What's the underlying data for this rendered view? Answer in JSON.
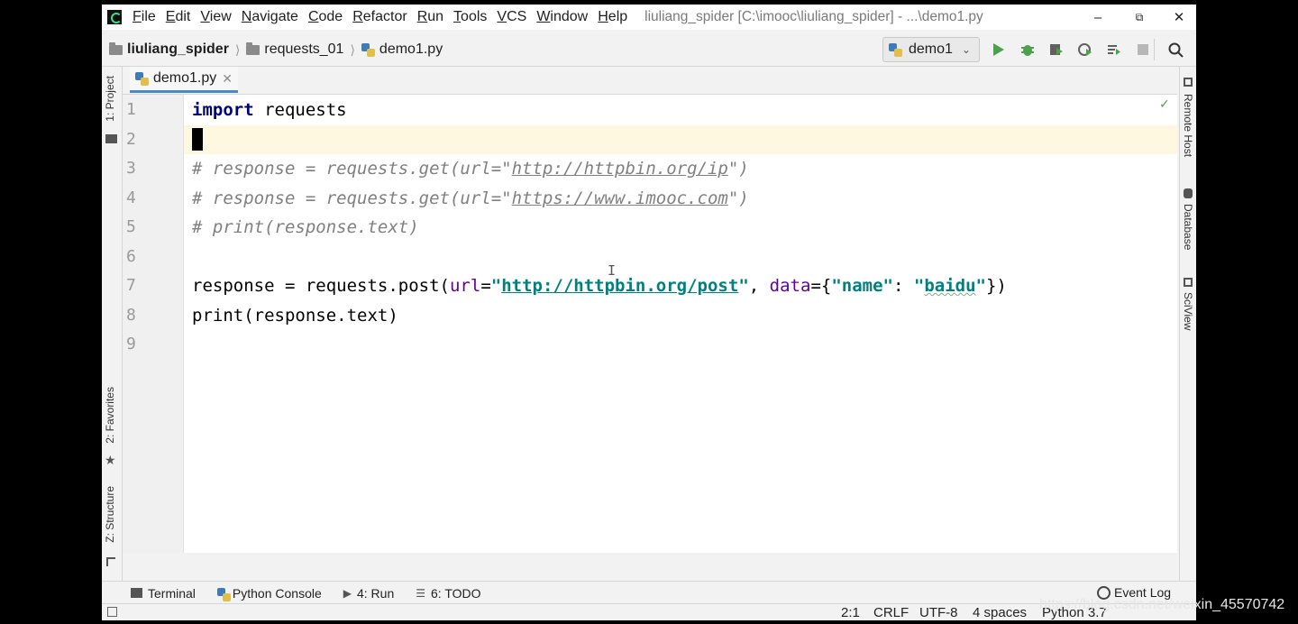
{
  "window": {
    "title_path": "liuliang_spider [C:\\imooc\\liuliang_spider] - ...\\demo1.py",
    "controls": {
      "minimize": "–",
      "restore": "⧉",
      "close": "✕"
    }
  },
  "menu": [
    "File",
    "Edit",
    "View",
    "Navigate",
    "Code",
    "Refactor",
    "Run",
    "Tools",
    "VCS",
    "Window",
    "Help"
  ],
  "breadcrumb": [
    "liuliang_spider",
    "requests_01",
    "demo1.py"
  ],
  "run_config": {
    "label": "demo1"
  },
  "tabs": [
    {
      "label": "demo1.py",
      "close": "✕"
    }
  ],
  "left_tools": {
    "project": "1: Project",
    "favorites": "2: Favorites",
    "structure": "Z: Structure"
  },
  "right_tools": {
    "remote_host": "Remote Host",
    "database": "Database",
    "sciview": "SciView"
  },
  "editor": {
    "line_numbers": [
      "1",
      "2",
      "3",
      "4",
      "5",
      "6",
      "7",
      "8",
      "9"
    ],
    "current_line": 2,
    "lines": [
      {
        "kw": "import",
        "rest": " requests"
      },
      {},
      {
        "c1": "# response = requests.get(url=\"",
        "url": "http://httpbin.org/ip",
        "c2": "\")"
      },
      {
        "c1": "# response = requests.get(url=\"",
        "url": "https://www.imooc.com",
        "c2": "\")"
      },
      {
        "c1": "# print(response.text)"
      },
      {},
      {
        "p1": "response = requests.post(",
        "kw1": "url",
        "p2": "=",
        "s1": "\"",
        "url": "http://httpbin.org/post",
        "s2": "\"",
        "p3": ", ",
        "kw2": "data",
        "p4": "={",
        "s3": "\"name\"",
        "p5": ": ",
        "s4a": "\"",
        "s4b": "baidu",
        "s4c": "\"",
        "p6": "})"
      },
      {
        "text": "print(response.text)"
      },
      {}
    ]
  },
  "bottom_tools": [
    {
      "label": "Terminal"
    },
    {
      "label": "Python Console"
    },
    {
      "label": "4: Run"
    },
    {
      "label": "6: TODO"
    }
  ],
  "event_log": "Event Log",
  "status": {
    "position": "2:1",
    "line_sep": "CRLF",
    "encoding": "UTF-8",
    "indent": "4 spaces",
    "interpreter": "Python 3.7"
  },
  "watermark": "https://blog.csdn.net/weixin_45570742",
  "colors": {
    "keyword": "#000080",
    "string": "#008080",
    "comment": "#808080",
    "kwarg": "#660099",
    "current_line": "#fdf8df",
    "tab_underline": "#4a88c7"
  }
}
